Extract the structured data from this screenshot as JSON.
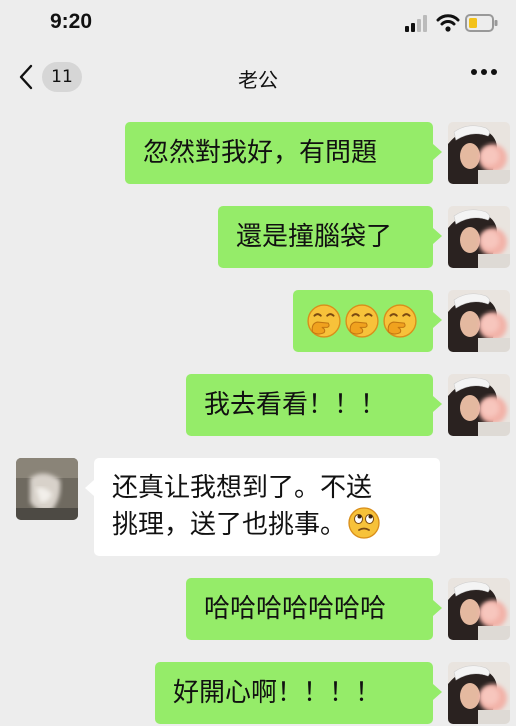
{
  "status": {
    "time": "9:20"
  },
  "nav": {
    "unread_count": "11",
    "title": "老公"
  },
  "messages": [
    {
      "sender": "me",
      "text": "忽然對我好，有問題"
    },
    {
      "sender": "me",
      "text": "還是撞腦袋了"
    },
    {
      "sender": "me",
      "emoji": [
        "hand-over-mouth-emoji",
        "hand-over-mouth-emoji",
        "hand-over-mouth-emoji"
      ]
    },
    {
      "sender": "me",
      "text": "我去看看！！！"
    },
    {
      "sender": "them",
      "line1": "还真让我想到了。不送",
      "line2": "挑理，送了也挑事。",
      "emoji": [
        "eye-roll-emoji"
      ]
    },
    {
      "sender": "me",
      "text": "哈哈哈哈哈哈哈"
    },
    {
      "sender": "me",
      "text": "好開心啊！！！！"
    }
  ],
  "colors": {
    "my_bubble": "#95ec69",
    "their_bubble": "#ffffff",
    "background": "#ededed"
  }
}
